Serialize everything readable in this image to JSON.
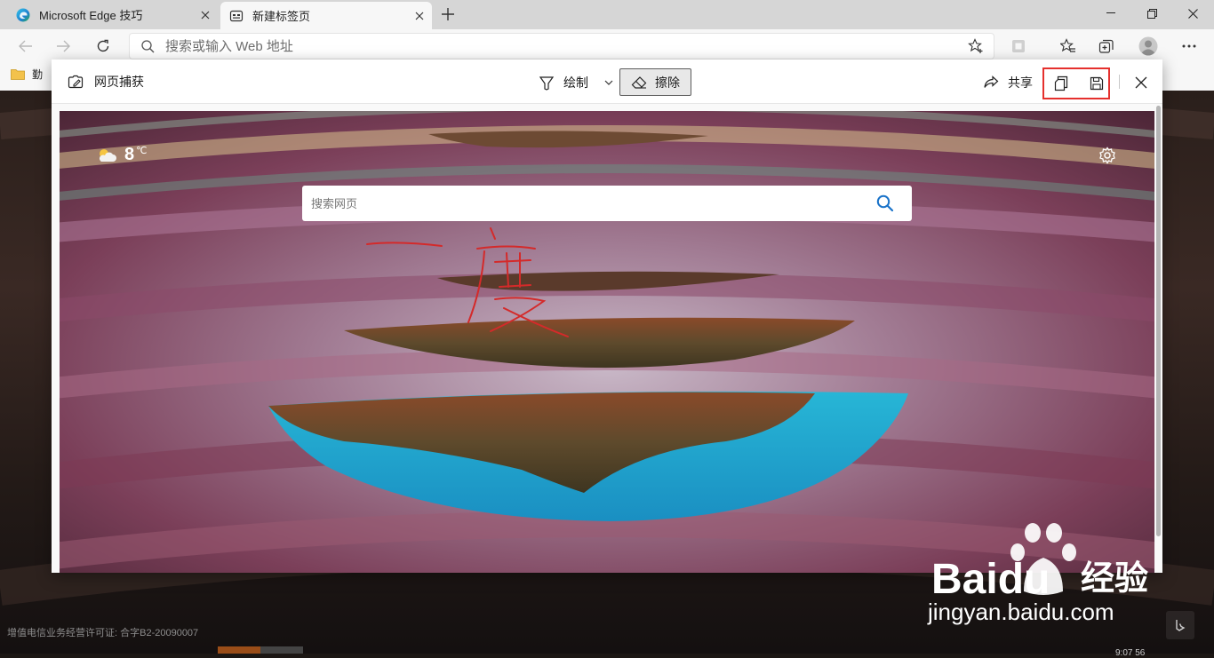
{
  "tabs": [
    {
      "title": "Microsoft Edge 技巧",
      "icon": "edge-logo-icon",
      "active": false
    },
    {
      "title": "新建标签页",
      "icon": "newtab-page-icon",
      "active": true
    }
  ],
  "address_bar": {
    "placeholder": "搜索或输入 Web 地址"
  },
  "favorites_bar": {
    "folder_label": "勤"
  },
  "web_capture": {
    "title": "网页捕获",
    "draw_label": "绘制",
    "erase_label": "擦除",
    "share_label": "共享"
  },
  "captured_page": {
    "weather_temp": "8",
    "weather_unit": "℃",
    "search_placeholder": "搜索网页",
    "handwriting": "一度"
  },
  "background_page": {
    "license_text": "增值电信业务经营许可证: 合字B2-20090007",
    "clock": "9:07 56"
  },
  "watermark": {
    "brand": "Baidu",
    "cn_label": "经验",
    "url": "jingyan.baidu.com"
  },
  "colors": {
    "highlight": "#e5302d",
    "ink": "#d42a2a",
    "search_accent": "#1a73c9"
  }
}
